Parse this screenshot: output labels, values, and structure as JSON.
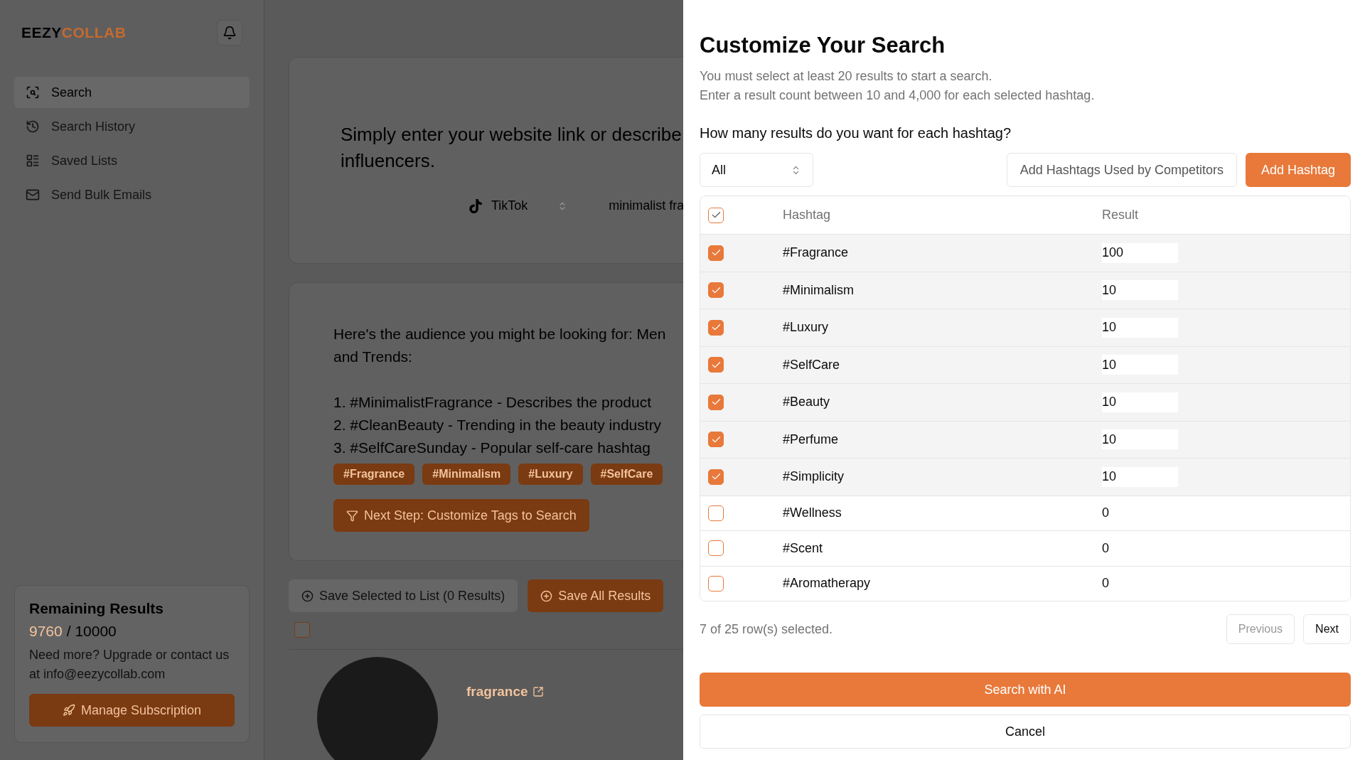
{
  "sidebar": {
    "logo": {
      "part_1": "EEZY",
      "part_2": "COLLAB"
    },
    "items": [
      {
        "label": "Search",
        "kind": "search",
        "selected": true
      },
      {
        "label": "Search History",
        "kind": "history",
        "selected": false
      },
      {
        "label": "Saved Lists",
        "kind": "lists",
        "selected": false
      },
      {
        "label": "Send Bulk Emails",
        "kind": "mail",
        "selected": false
      }
    ],
    "usage": {
      "title": "Remaining Results",
      "used": "9760",
      "total": "/ 10000",
      "note": "Need more? Upgrade or contact us at info@eezycollab.com",
      "button": "Manage Subscription"
    }
  },
  "main": {
    "intro": "Simply enter your website link or describe",
    "intro_2": "influencers.",
    "platform": "TikTok",
    "query": "minimalist fra",
    "audience": [
      "Here's the audience you might be looking for: Men",
      "and Trends:"
    ],
    "suggestions": [
      "1. #MinimalistFragrance - Describes the product",
      "2. #CleanBeauty - Trending in the beauty industry",
      "3. #SelfCareSunday - Popular self-care hashtag"
    ],
    "tags": [
      "#Fragrance",
      "#Minimalism",
      "#Luxury",
      "#SelfCare"
    ],
    "next_button": "Next Step: Customize Tags to Search",
    "save_selected": "Save Selected to List (0 Results)",
    "save_all": "Save All Results",
    "result": {
      "name": "fragrance",
      "checked": false
    }
  },
  "modal": {
    "title": "Customize Your Search",
    "description": [
      "You must select at least 20 results to start a search.",
      "Enter a result count between 10 and 4,000 for each selected hashtag."
    ],
    "question": "How many results do you want for each hashtag?",
    "filter": "All",
    "competitors_button": "Add Hashtags Used by Competitors",
    "add_button": "Add Hashtag",
    "table": {
      "select_all": {
        "checked": true
      },
      "columns": [
        "Hashtag",
        "Result"
      ],
      "rows": [
        {
          "hashtag": "#Fragrance",
          "result": "100",
          "checked": true
        },
        {
          "hashtag": "#Minimalism",
          "result": "10",
          "checked": true
        },
        {
          "hashtag": "#Luxury",
          "result": "10",
          "checked": true
        },
        {
          "hashtag": "#SelfCare",
          "result": "10",
          "checked": true
        },
        {
          "hashtag": "#Beauty",
          "result": "10",
          "checked": true
        },
        {
          "hashtag": "#Perfume",
          "result": "10",
          "checked": true
        },
        {
          "hashtag": "#Simplicity",
          "result": "10",
          "checked": true
        },
        {
          "hashtag": "#Wellness",
          "result": "0",
          "checked": false
        },
        {
          "hashtag": "#Scent",
          "result": "0",
          "checked": false
        },
        {
          "hashtag": "#Aromatherapy",
          "result": "0",
          "checked": false
        }
      ]
    },
    "selection_text": "7 of 25 row(s) selected.",
    "previous": {
      "label": "Previous",
      "disabled": true
    },
    "next": {
      "label": "Next",
      "disabled": false
    },
    "primary": "Search with AI",
    "cancel": "Cancel"
  }
}
